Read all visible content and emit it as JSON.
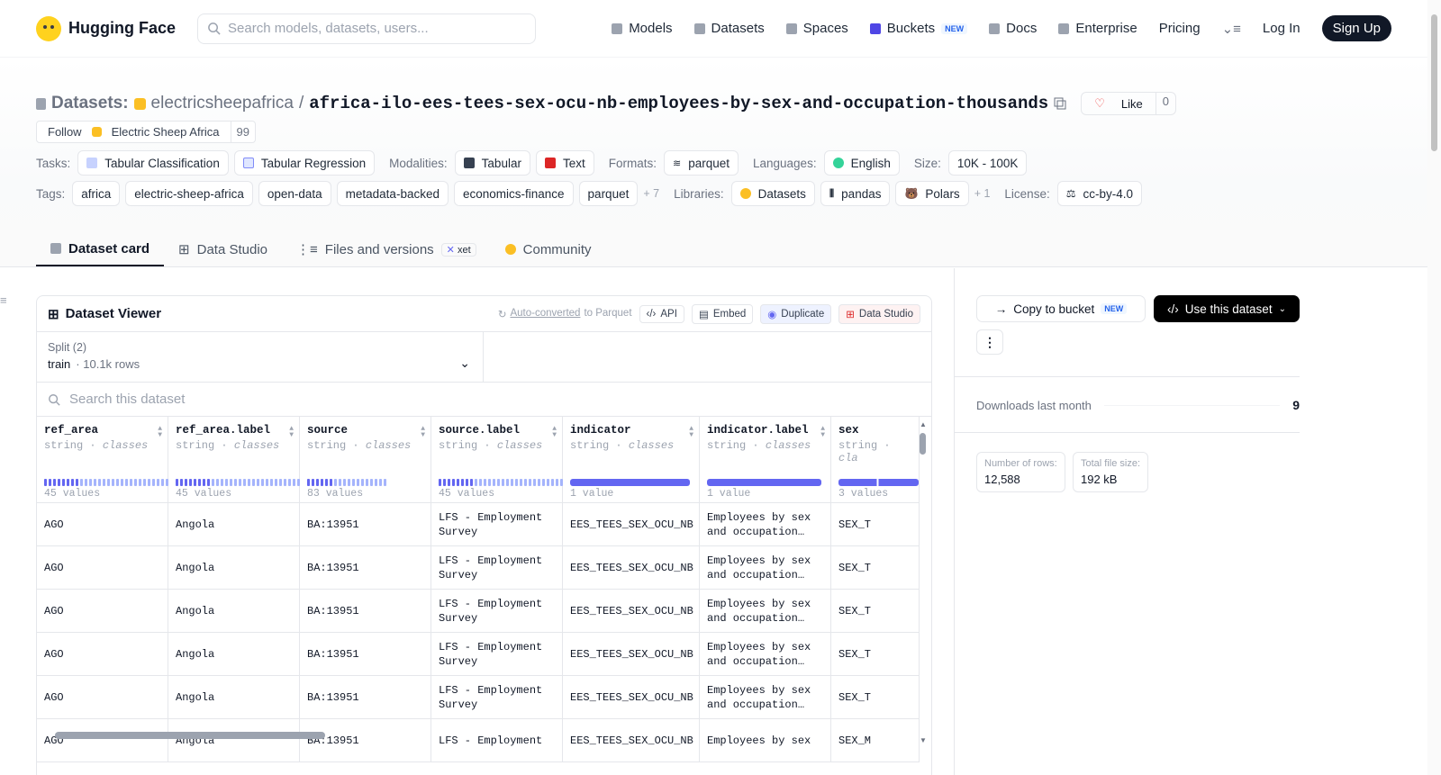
{
  "nav": {
    "brand": "Hugging Face",
    "search_placeholder": "Search models, datasets, users...",
    "links": [
      {
        "label": "Models",
        "icon": "cube-icon"
      },
      {
        "label": "Datasets",
        "icon": "database-icon"
      },
      {
        "label": "Spaces",
        "icon": "grid-icon"
      },
      {
        "label": "Buckets",
        "icon": "bucket-icon",
        "badge": "NEW"
      },
      {
        "label": "Docs",
        "icon": "book-icon"
      },
      {
        "label": "Enterprise",
        "icon": "building-icon"
      },
      {
        "label": "Pricing"
      }
    ],
    "login": "Log In",
    "signup": "Sign Up"
  },
  "header": {
    "prefix": "Datasets:",
    "owner": "electricsheepafrica",
    "separator": "/",
    "name": "africa-ilo-ees-tees-sex-ocu-nb-employees-by-sex-and-occupation-thousands",
    "like_label": "Like",
    "like_count": "0",
    "follow_label": "Follow",
    "follow_org": "Electric Sheep Africa",
    "follow_count": "99"
  },
  "meta": {
    "tasks_label": "Tasks:",
    "tasks": [
      "Tabular Classification",
      "Tabular Regression"
    ],
    "modalities_label": "Modalities:",
    "modalities": [
      "Tabular",
      "Text"
    ],
    "formats_label": "Formats:",
    "formats": [
      "parquet"
    ],
    "languages_label": "Languages:",
    "languages": [
      "English"
    ],
    "size_label": "Size:",
    "size": "10K - 100K",
    "tags_label": "Tags:",
    "tags": [
      "africa",
      "electric-sheep-africa",
      "open-data",
      "metadata-backed",
      "economics-finance",
      "parquet"
    ],
    "tags_more": "+ 7",
    "libraries_label": "Libraries:",
    "libraries": [
      "Datasets",
      "pandas",
      "Polars"
    ],
    "libraries_more": "+ 1",
    "license_label": "License:",
    "license": "cc-by-4.0"
  },
  "tabs": [
    {
      "label": "Dataset card",
      "active": true
    },
    {
      "label": "Data Studio"
    },
    {
      "label": "Files and versions",
      "badge": "xet"
    },
    {
      "label": "Community"
    }
  ],
  "viewer": {
    "title": "Dataset Viewer",
    "auto_converted": "Auto-converted",
    "to_parquet": "to Parquet",
    "api": "API",
    "embed": "Embed",
    "duplicate": "Duplicate",
    "data_studio": "Data Studio",
    "split_label": "Split (2)",
    "split_value": "train",
    "split_rows": "10.1k rows",
    "search_placeholder": "Search this dataset",
    "columns": [
      {
        "name": "ref_area",
        "type": "string",
        "kind": "classes",
        "count": "45 values"
      },
      {
        "name": "ref_area.label",
        "type": "string",
        "kind": "classes",
        "count": "45 values"
      },
      {
        "name": "source",
        "type": "string",
        "kind": "classes",
        "count": "83 values"
      },
      {
        "name": "source.label",
        "type": "string",
        "kind": "classes",
        "count": "45 values"
      },
      {
        "name": "indicator",
        "type": "string",
        "kind": "classes",
        "count": "1 value"
      },
      {
        "name": "indicator.label",
        "type": "string",
        "kind": "classes",
        "count": "1 value"
      },
      {
        "name": "sex",
        "type": "string",
        "kind": "cla",
        "count": "3 values"
      }
    ],
    "rows": [
      [
        "AGO",
        "Angola",
        "BA:13951",
        "LFS - Employment\nSurvey",
        "EES_TEES_SEX_OCU_NB",
        "Employees by sex\nand occupation…",
        "SEX_T"
      ],
      [
        "AGO",
        "Angola",
        "BA:13951",
        "LFS - Employment\nSurvey",
        "EES_TEES_SEX_OCU_NB",
        "Employees by sex\nand occupation…",
        "SEX_T"
      ],
      [
        "AGO",
        "Angola",
        "BA:13951",
        "LFS - Employment\nSurvey",
        "EES_TEES_SEX_OCU_NB",
        "Employees by sex\nand occupation…",
        "SEX_T"
      ],
      [
        "AGO",
        "Angola",
        "BA:13951",
        "LFS - Employment\nSurvey",
        "EES_TEES_SEX_OCU_NB",
        "Employees by sex\nand occupation…",
        "SEX_T"
      ],
      [
        "AGO",
        "Angola",
        "BA:13951",
        "LFS - Employment\nSurvey",
        "EES_TEES_SEX_OCU_NB",
        "Employees by sex\nand occupation…",
        "SEX_T"
      ],
      [
        "AGO",
        "Angola",
        "BA:13951",
        "LFS - Employment",
        "EES_TEES_SEX_OCU_NB",
        "Employees by sex",
        "SEX_M"
      ]
    ]
  },
  "sidebar": {
    "copy_label": "Copy to bucket",
    "copy_badge": "NEW",
    "use_label": "Use this dataset",
    "downloads_label": "Downloads last month",
    "downloads": "9",
    "rows_label": "Number of rows:",
    "rows_value": "12,588",
    "size_label": "Total file size:",
    "size_value": "192 kB"
  },
  "colors": {
    "accent": "#6366f1",
    "primary": "#111827"
  }
}
